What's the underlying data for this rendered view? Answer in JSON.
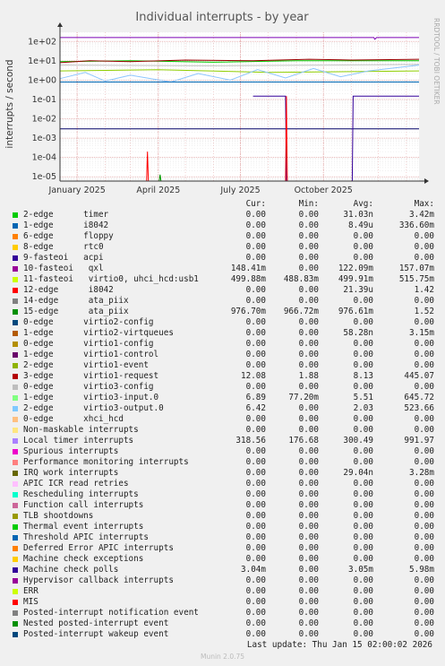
{
  "chart_data": {
    "type": "line",
    "title": "Individual interrupts - by year",
    "ylabel": "interrupts / second",
    "side_label": "RRDTOOL / TOBI OETIKER",
    "y_scale": "log",
    "ylim": [
      6e-06,
      300
    ],
    "y_ticks": [
      "1e+02",
      "1e+01",
      "1e+00",
      "1e-01",
      "1e-02",
      "1e-03",
      "1e-04",
      "1e-05"
    ],
    "x_start": "2024-12-13",
    "x_end": "2026-01-15",
    "x_ticks": [
      {
        "date": "2025-01-01",
        "label": "January 2025"
      },
      {
        "date": "2025-04-01",
        "label": "April 2025"
      },
      {
        "date": "2025-07-01",
        "label": "July 2025"
      },
      {
        "date": "2025-10-01",
        "label": "October 2025"
      }
    ],
    "grid": true,
    "lines": [
      {
        "color": "#7b00b3",
        "points": [
          [
            "2024-12-13",
            160
          ],
          [
            "2025-11-26",
            160
          ],
          [
            "2025-11-27",
            130
          ],
          [
            "2025-11-29",
            160
          ],
          [
            "2026-01-15",
            160
          ]
        ]
      },
      {
        "color": "#00cc00",
        "points": [
          [
            "2024-12-13",
            9
          ],
          [
            "2025-03-01",
            10
          ],
          [
            "2025-06-01",
            8.5
          ],
          [
            "2025-09-01",
            10
          ],
          [
            "2026-01-15",
            10
          ]
        ]
      },
      {
        "color": "#c0c0c0",
        "points": [
          [
            "2024-12-13",
            6
          ],
          [
            "2025-06-01",
            5.5
          ],
          [
            "2026-01-15",
            6.5
          ]
        ]
      },
      {
        "color": "#8fce00",
        "points": [
          [
            "2024-12-13",
            3
          ],
          [
            "2025-04-01",
            3.5
          ],
          [
            "2025-08-01",
            2.5
          ],
          [
            "2026-01-15",
            3
          ]
        ]
      },
      {
        "color": "#990000",
        "points": [
          [
            "2024-12-13",
            8
          ],
          [
            "2025-01-15",
            10
          ],
          [
            "2025-03-01",
            9
          ],
          [
            "2025-05-01",
            11
          ],
          [
            "2025-07-15",
            10
          ],
          [
            "2025-09-15",
            12
          ],
          [
            "2025-11-01",
            11
          ],
          [
            "2026-01-15",
            12
          ]
        ]
      },
      {
        "color": "#8ec6ff",
        "points": [
          [
            "2024-12-13",
            1.2
          ],
          [
            "2025-01-10",
            2.5
          ],
          [
            "2025-02-01",
            0.9
          ],
          [
            "2025-03-01",
            1.8
          ],
          [
            "2025-04-15",
            0.8
          ],
          [
            "2025-05-15",
            2.2
          ],
          [
            "2025-06-20",
            1.0
          ],
          [
            "2025-07-20",
            3.5
          ],
          [
            "2025-08-20",
            1.3
          ],
          [
            "2025-09-20",
            4.0
          ],
          [
            "2025-10-20",
            1.5
          ],
          [
            "2025-11-20",
            3.0
          ],
          [
            "2026-01-15",
            6.0
          ]
        ]
      },
      {
        "color": "#0066b3",
        "points": [
          [
            "2024-12-13",
            0.8
          ],
          [
            "2026-01-15",
            0.8
          ]
        ]
      },
      {
        "color": "#000066",
        "points": [
          [
            "2024-12-13",
            0.003
          ],
          [
            "2026-01-15",
            0.003
          ]
        ]
      },
      {
        "color": "#330099",
        "points": [
          [
            "2025-07-15",
            0.15
          ],
          [
            "2025-08-20",
            0.15
          ],
          [
            "2025-08-21",
            6e-06
          ],
          [
            "2025-11-02",
            6e-06
          ],
          [
            "2025-11-03",
            0.15
          ],
          [
            "2026-01-15",
            0.15
          ]
        ]
      },
      {
        "color": "#ff0000",
        "points": [
          [
            "2025-03-19",
            6e-06
          ],
          [
            "2025-03-20",
            0.0002
          ],
          [
            "2025-03-21",
            6e-06
          ],
          [
            "2025-08-20",
            6e-06
          ],
          [
            "2025-08-21",
            0.15
          ],
          [
            "2025-08-22",
            6e-06
          ]
        ]
      },
      {
        "color": "#009900",
        "points": [
          [
            "2025-04-02",
            6e-06
          ],
          [
            "2025-04-03",
            1.3e-05
          ],
          [
            "2025-04-04",
            6e-06
          ]
        ]
      }
    ]
  },
  "legend": {
    "headers": {
      "cur": "Cur:",
      "min": "Min:",
      "avg": "Avg:",
      "max": "Max:"
    },
    "rows": [
      {
        "color": "#00cc00",
        "label": "2-edge      timer",
        "cur": "0.00",
        "min": "0.00",
        "avg": "31.03n",
        "max": "3.42m"
      },
      {
        "color": "#0066b3",
        "label": "1-edge      i8042",
        "cur": "0.00",
        "min": "0.00",
        "avg": "8.49u",
        "max": "336.60m"
      },
      {
        "color": "#ff8000",
        "label": "6-edge      floppy",
        "cur": "0.00",
        "min": "0.00",
        "avg": "0.00",
        "max": "0.00"
      },
      {
        "color": "#ffcc00",
        "label": "8-edge      rtc0",
        "cur": "0.00",
        "min": "0.00",
        "avg": "0.00",
        "max": "0.00"
      },
      {
        "color": "#330099",
        "label": "9-fasteoi   acpi",
        "cur": "0.00",
        "min": "0.00",
        "avg": "0.00",
        "max": "0.00"
      },
      {
        "color": "#990099",
        "label": "10-fasteoi   qxl",
        "cur": "148.41m",
        "min": "0.00",
        "avg": "122.09m",
        "max": "157.07m"
      },
      {
        "color": "#ccff00",
        "label": "11-fasteoi   virtio0, uhci_hcd:usb1",
        "cur": "499.88m",
        "min": "488.83m",
        "avg": "499.91m",
        "max": "515.75m"
      },
      {
        "color": "#ff0000",
        "label": "12-edge      i8042",
        "cur": "0.00",
        "min": "0.00",
        "avg": "21.39u",
        "max": "1.42"
      },
      {
        "color": "#808080",
        "label": "14-edge      ata_piix",
        "cur": "0.00",
        "min": "0.00",
        "avg": "0.00",
        "max": "0.00"
      },
      {
        "color": "#008f00",
        "label": "15-edge      ata_piix",
        "cur": "976.70m",
        "min": "966.72m",
        "avg": "976.61m",
        "max": "1.52"
      },
      {
        "color": "#00487d",
        "label": "0-edge      virtio2-config",
        "cur": "0.00",
        "min": "0.00",
        "avg": "0.00",
        "max": "0.00"
      },
      {
        "color": "#b35a00",
        "label": "1-edge      virtio2-virtqueues",
        "cur": "0.00",
        "min": "0.00",
        "avg": "58.28n",
        "max": "3.15m"
      },
      {
        "color": "#b38f00",
        "label": "0-edge      virtio1-config",
        "cur": "0.00",
        "min": "0.00",
        "avg": "0.00",
        "max": "0.00"
      },
      {
        "color": "#6b006b",
        "label": "1-edge      virtio1-control",
        "cur": "0.00",
        "min": "0.00",
        "avg": "0.00",
        "max": "0.00"
      },
      {
        "color": "#8fb300",
        "label": "2-edge      virtio1-event",
        "cur": "0.00",
        "min": "0.00",
        "avg": "0.00",
        "max": "0.00"
      },
      {
        "color": "#b30000",
        "label": "3-edge      virtio1-request",
        "cur": "12.08",
        "min": "1.88",
        "avg": "8.13",
        "max": "445.07"
      },
      {
        "color": "#bebebe",
        "label": "0-edge      virtio3-config",
        "cur": "0.00",
        "min": "0.00",
        "avg": "0.00",
        "max": "0.00"
      },
      {
        "color": "#80ff80",
        "label": "1-edge      virtio3-input.0",
        "cur": "6.89",
        "min": "77.20m",
        "avg": "5.51",
        "max": "645.72"
      },
      {
        "color": "#80c9ff",
        "label": "2-edge      virtio3-output.0",
        "cur": "6.42",
        "min": "0.00",
        "avg": "2.03",
        "max": "523.66"
      },
      {
        "color": "#ffc080",
        "label": "0-edge      xhci_hcd",
        "cur": "0.00",
        "min": "0.00",
        "avg": "0.00",
        "max": "0.00"
      },
      {
        "color": "#ffe680",
        "label": "Non-maskable interrupts",
        "cur": "0.00",
        "min": "0.00",
        "avg": "0.00",
        "max": "0.00"
      },
      {
        "color": "#aa80ff",
        "label": "Local timer interrupts",
        "cur": "318.56",
        "min": "176.68",
        "avg": "300.49",
        "max": "991.97"
      },
      {
        "color": "#ee00cc",
        "label": "Spurious interrupts",
        "cur": "0.00",
        "min": "0.00",
        "avg": "0.00",
        "max": "0.00"
      },
      {
        "color": "#ff8080",
        "label": "Performance monitoring interrupts",
        "cur": "0.00",
        "min": "0.00",
        "avg": "0.00",
        "max": "0.00"
      },
      {
        "color": "#666600",
        "label": "IRQ work interrupts",
        "cur": "0.00",
        "min": "0.00",
        "avg": "29.04n",
        "max": "3.28m"
      },
      {
        "color": "#ffbfff",
        "label": "APIC ICR read retries",
        "cur": "0.00",
        "min": "0.00",
        "avg": "0.00",
        "max": "0.00"
      },
      {
        "color": "#00ffcc",
        "label": "Rescheduling interrupts",
        "cur": "0.00",
        "min": "0.00",
        "avg": "0.00",
        "max": "0.00"
      },
      {
        "color": "#cc6699",
        "label": "Function call interrupts",
        "cur": "0.00",
        "min": "0.00",
        "avg": "0.00",
        "max": "0.00"
      },
      {
        "color": "#999900",
        "label": "TLB shootdowns",
        "cur": "0.00",
        "min": "0.00",
        "avg": "0.00",
        "max": "0.00"
      },
      {
        "color": "#00cc00",
        "label": "Thermal event interrupts",
        "cur": "0.00",
        "min": "0.00",
        "avg": "0.00",
        "max": "0.00"
      },
      {
        "color": "#0066b3",
        "label": "Threshold APIC interrupts",
        "cur": "0.00",
        "min": "0.00",
        "avg": "0.00",
        "max": "0.00"
      },
      {
        "color": "#ff8000",
        "label": "Deferred Error APIC interrupts",
        "cur": "0.00",
        "min": "0.00",
        "avg": "0.00",
        "max": "0.00"
      },
      {
        "color": "#ffcc00",
        "label": "Machine check exceptions",
        "cur": "0.00",
        "min": "0.00",
        "avg": "0.00",
        "max": "0.00"
      },
      {
        "color": "#330099",
        "label": "Machine check polls",
        "cur": "3.04m",
        "min": "0.00",
        "avg": "3.05m",
        "max": "5.98m"
      },
      {
        "color": "#990099",
        "label": "Hypervisor callback interrupts",
        "cur": "0.00",
        "min": "0.00",
        "avg": "0.00",
        "max": "0.00"
      },
      {
        "color": "#ccff00",
        "label": "ERR",
        "cur": "0.00",
        "min": "0.00",
        "avg": "0.00",
        "max": "0.00"
      },
      {
        "color": "#ff0000",
        "label": "MIS",
        "cur": "0.00",
        "min": "0.00",
        "avg": "0.00",
        "max": "0.00"
      },
      {
        "color": "#808080",
        "label": "Posted-interrupt notification event",
        "cur": "0.00",
        "min": "0.00",
        "avg": "0.00",
        "max": "0.00"
      },
      {
        "color": "#008f00",
        "label": "Nested posted-interrupt event",
        "cur": "0.00",
        "min": "0.00",
        "avg": "0.00",
        "max": "0.00"
      },
      {
        "color": "#00487d",
        "label": "Posted-interrupt wakeup event",
        "cur": "0.00",
        "min": "0.00",
        "avg": "0.00",
        "max": "0.00"
      }
    ]
  },
  "last_update": "Last update: Thu Jan 15 02:00:02 2026",
  "footer": "Munin 2.0.75"
}
